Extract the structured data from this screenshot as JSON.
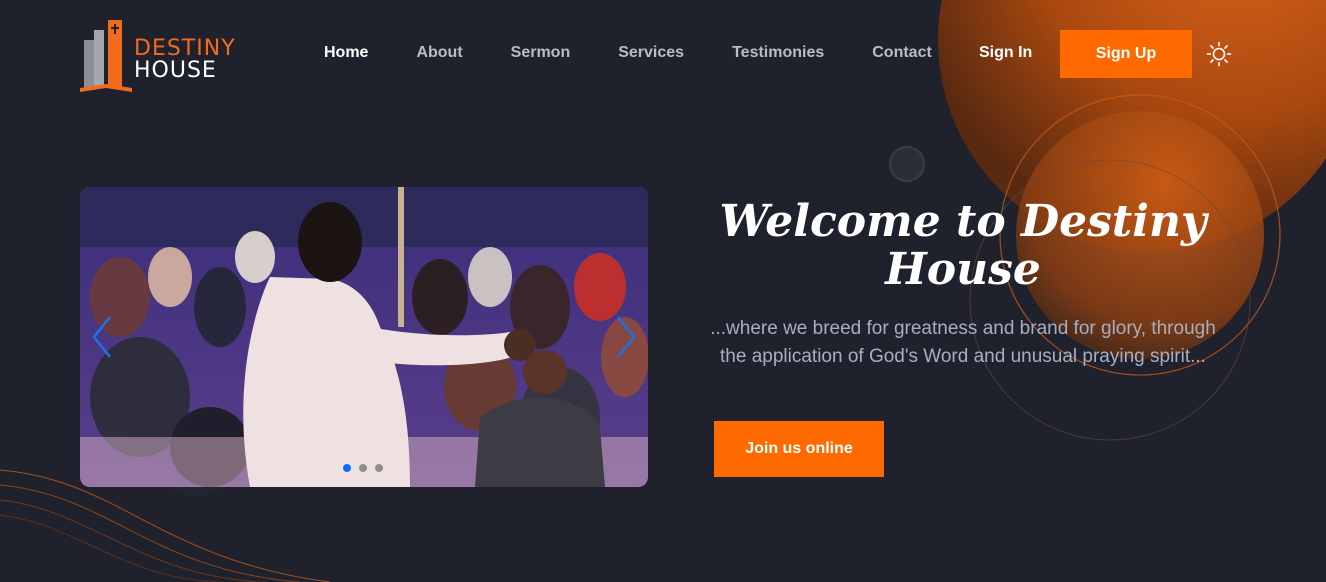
{
  "brand": {
    "line1": "DESTINY",
    "line2": "HOUSE"
  },
  "nav": [
    {
      "label": "Home",
      "active": true
    },
    {
      "label": "About"
    },
    {
      "label": "Sermon"
    },
    {
      "label": "Services"
    },
    {
      "label": "Testimonies"
    },
    {
      "label": "Contact"
    }
  ],
  "auth": {
    "signin": "Sign In",
    "signup": "Sign Up"
  },
  "theme_toggle_icon": "sun-icon",
  "hero": {
    "title": "Welcome to Destiny House",
    "subtitle": "...where we breed for greatness and brand for glory, through the application of God's Word and unusual praying spirit...",
    "cta": "Join us online"
  },
  "carousel": {
    "slide_count": 3,
    "active_index": 0,
    "prev_icon": "chevron-left-icon",
    "next_icon": "chevron-right-icon"
  },
  "colors": {
    "accent": "#ff6a00",
    "background": "#1f222d",
    "active_dot": "#0d6efd"
  }
}
